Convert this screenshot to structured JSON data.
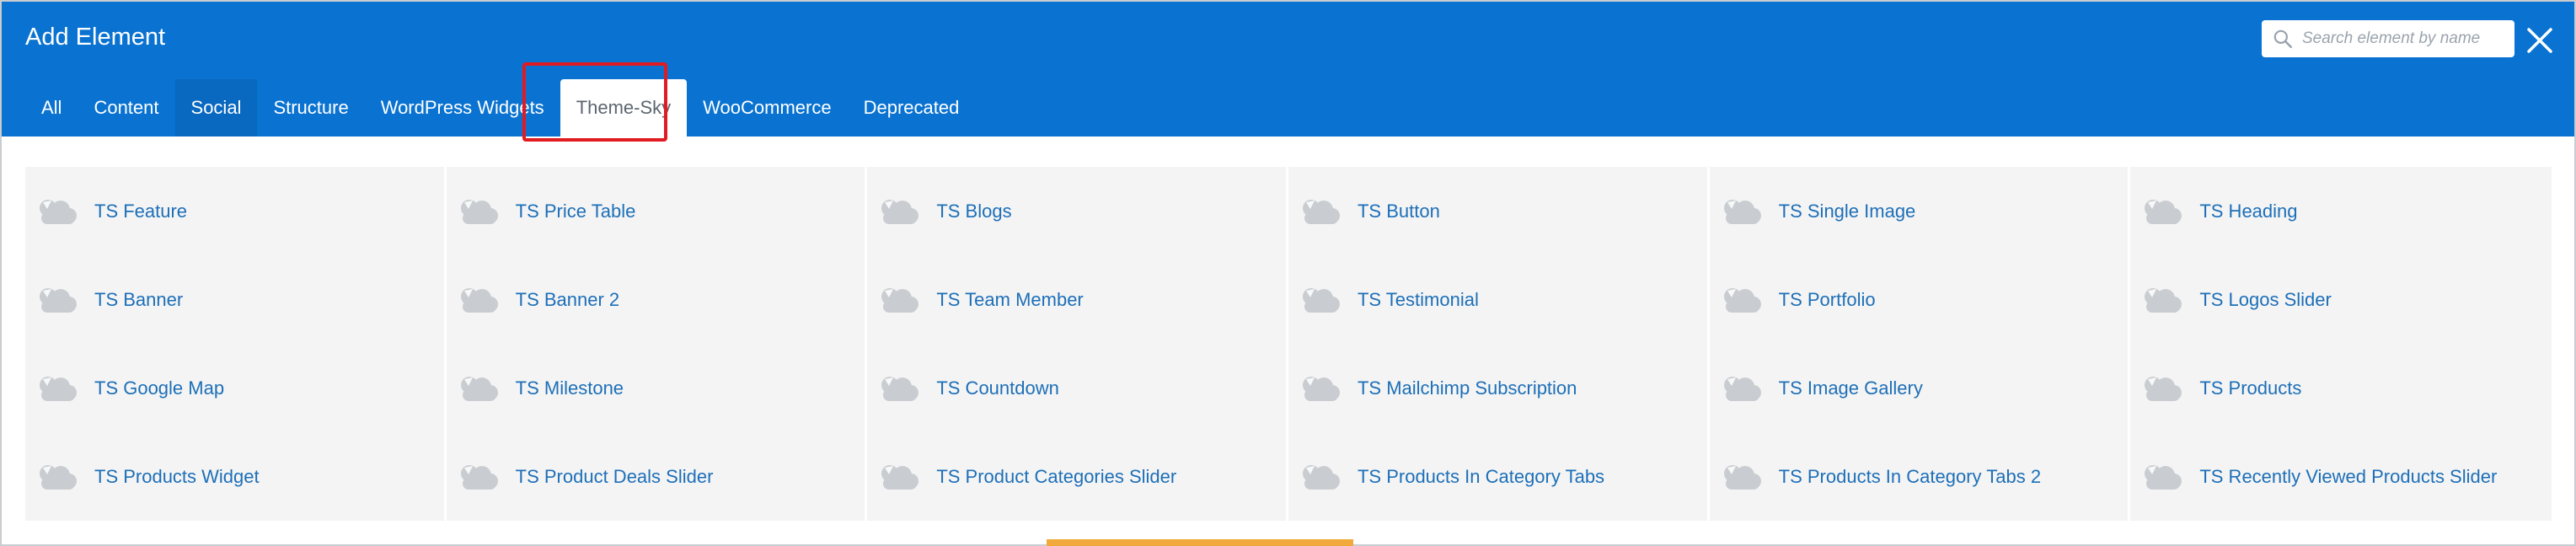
{
  "header": {
    "title": "Add Element",
    "search_placeholder": "Search element by name",
    "colors": {
      "bar": "#0a73d1",
      "active_tab_text": "#5c6670",
      "label": "#1d6fb8",
      "highlight": "#e11b22"
    }
  },
  "tabs": [
    {
      "label": "All"
    },
    {
      "label": "Content"
    },
    {
      "label": "Social"
    },
    {
      "label": "Structure"
    },
    {
      "label": "WordPress Widgets"
    },
    {
      "label": "Theme-Sky"
    },
    {
      "label": "WooCommerce"
    },
    {
      "label": "Deprecated"
    }
  ],
  "active_tab": "Theme-Sky",
  "elements": [
    {
      "label": "TS Feature",
      "icon": "cloud-icon"
    },
    {
      "label": "TS Price Table",
      "icon": "cloud-icon"
    },
    {
      "label": "TS Blogs",
      "icon": "cloud-icon"
    },
    {
      "label": "TS Button",
      "icon": "cloud-icon"
    },
    {
      "label": "TS Single Image",
      "icon": "cloud-icon"
    },
    {
      "label": "TS Heading",
      "icon": "cloud-icon"
    },
    {
      "label": "TS Banner",
      "icon": "cloud-icon"
    },
    {
      "label": "TS Banner 2",
      "icon": "cloud-icon"
    },
    {
      "label": "TS Team Member",
      "icon": "cloud-icon"
    },
    {
      "label": "TS Testimonial",
      "icon": "cloud-icon"
    },
    {
      "label": "TS Portfolio",
      "icon": "cloud-icon"
    },
    {
      "label": "TS Logos Slider",
      "icon": "cloud-icon"
    },
    {
      "label": "TS Google Map",
      "icon": "cloud-icon"
    },
    {
      "label": "TS Milestone",
      "icon": "cloud-icon"
    },
    {
      "label": "TS Countdown",
      "icon": "cloud-icon"
    },
    {
      "label": "TS Mailchimp Subscription",
      "icon": "cloud-icon"
    },
    {
      "label": "TS Image Gallery",
      "icon": "cloud-icon"
    },
    {
      "label": "TS Products",
      "icon": "cloud-icon"
    },
    {
      "label": "TS Products Widget",
      "icon": "cloud-icon"
    },
    {
      "label": "TS Product Deals Slider",
      "icon": "cloud-icon"
    },
    {
      "label": "TS Product Categories Slider",
      "icon": "cloud-icon"
    },
    {
      "label": "TS Products In Category Tabs",
      "icon": "cloud-icon"
    },
    {
      "label": "TS Products In Category Tabs 2",
      "icon": "cloud-icon"
    },
    {
      "label": "TS Recently Viewed Products Slider",
      "icon": "cloud-icon"
    }
  ]
}
